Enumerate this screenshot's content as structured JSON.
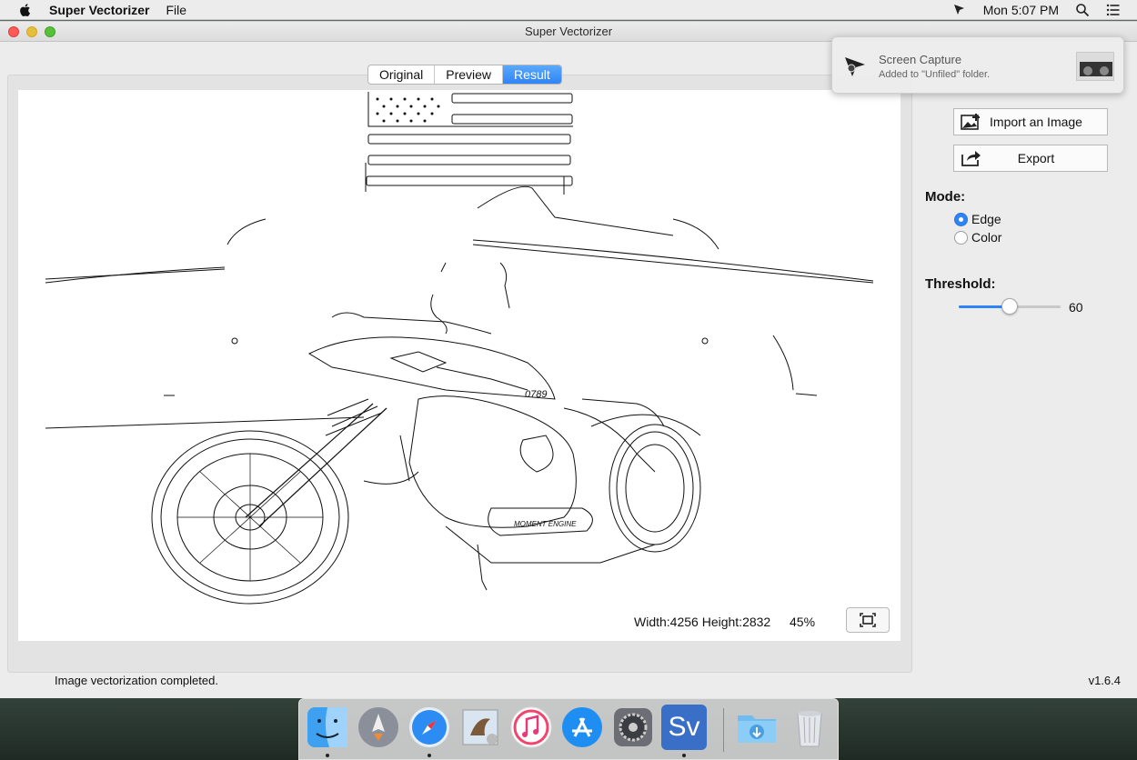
{
  "menubar": {
    "app_name": "Super Vectorizer",
    "menus": [
      "File"
    ],
    "clock": "Mon 5:07 PM",
    "icons": [
      "apple-icon",
      "capture-icon",
      "spotlight-icon",
      "notification-center-icon"
    ]
  },
  "window": {
    "title": "Super Vectorizer",
    "tabs": [
      {
        "label": "Original",
        "active": false
      },
      {
        "label": "Preview",
        "active": false
      },
      {
        "label": "Result",
        "active": true
      }
    ],
    "canvas": {
      "info": "Width:4256 Height:2832",
      "zoom": "45%"
    },
    "sidebar": {
      "import_label": "Import an Image",
      "export_label": "Export",
      "mode_label": "Mode:",
      "mode_options": [
        {
          "label": "Edge",
          "selected": true
        },
        {
          "label": "Color",
          "selected": false
        }
      ],
      "threshold_label": "Threshold:",
      "threshold_value": "60",
      "threshold_fraction": 0.5
    },
    "status": "Image vectorization completed.",
    "version": "v1.6.4"
  },
  "notification": {
    "title": "Screen Capture",
    "body": "Added to \"Unfiled\" folder."
  },
  "dock": {
    "apps": [
      "finder-icon",
      "launchpad-icon",
      "safari-icon",
      "mail-icon",
      "itunes-icon",
      "app-store-icon",
      "system-preferences-icon",
      "super-vectorizer-icon",
      "downloads-folder-icon",
      "trash-icon"
    ],
    "sv_label": "Sv"
  },
  "colors": {
    "accent": "#2f84f5",
    "window_bg": "#ececec"
  }
}
